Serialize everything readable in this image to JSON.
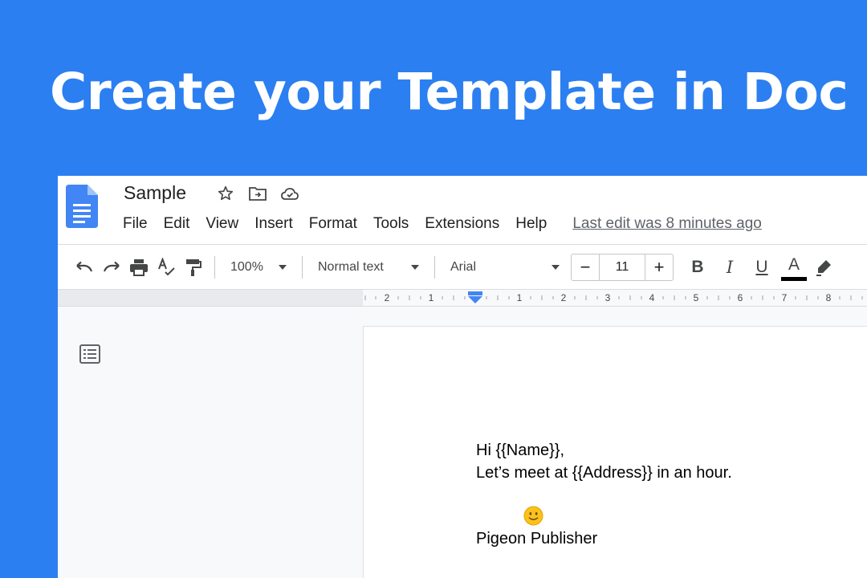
{
  "headline": "Create your Template in Doc",
  "doc": {
    "title": "Sample",
    "menu": [
      "File",
      "Edit",
      "View",
      "Insert",
      "Format",
      "Tools",
      "Extensions",
      "Help"
    ],
    "last_edit": "Last edit was 8 minutes ago"
  },
  "toolbar": {
    "zoom": "100%",
    "style": "Normal text",
    "font": "Arial",
    "font_size": "11",
    "minus": "−",
    "plus": "+",
    "bold": "B",
    "italic": "I",
    "underline": "U",
    "text_color": "A"
  },
  "ruler": {
    "labels": [
      "2",
      "1",
      "1",
      "2",
      "3",
      "4",
      "5",
      "6",
      "7",
      "8"
    ]
  },
  "content": {
    "line1": "Hi {{Name}},",
    "line2": "Let’s meet at {{Address}} in an hour.",
    "signature": "Pigeon Publisher"
  },
  "colors": {
    "background": "#2b7ff0",
    "docs_blue": "#4285f4"
  },
  "icons": {
    "doc_logo": "google-docs-icon",
    "star": "star-icon",
    "move": "move-to-folder-icon",
    "cloud": "cloud-saved-icon",
    "outline": "document-outline-icon",
    "emoji": "slightly-smiling-face-emoji"
  }
}
